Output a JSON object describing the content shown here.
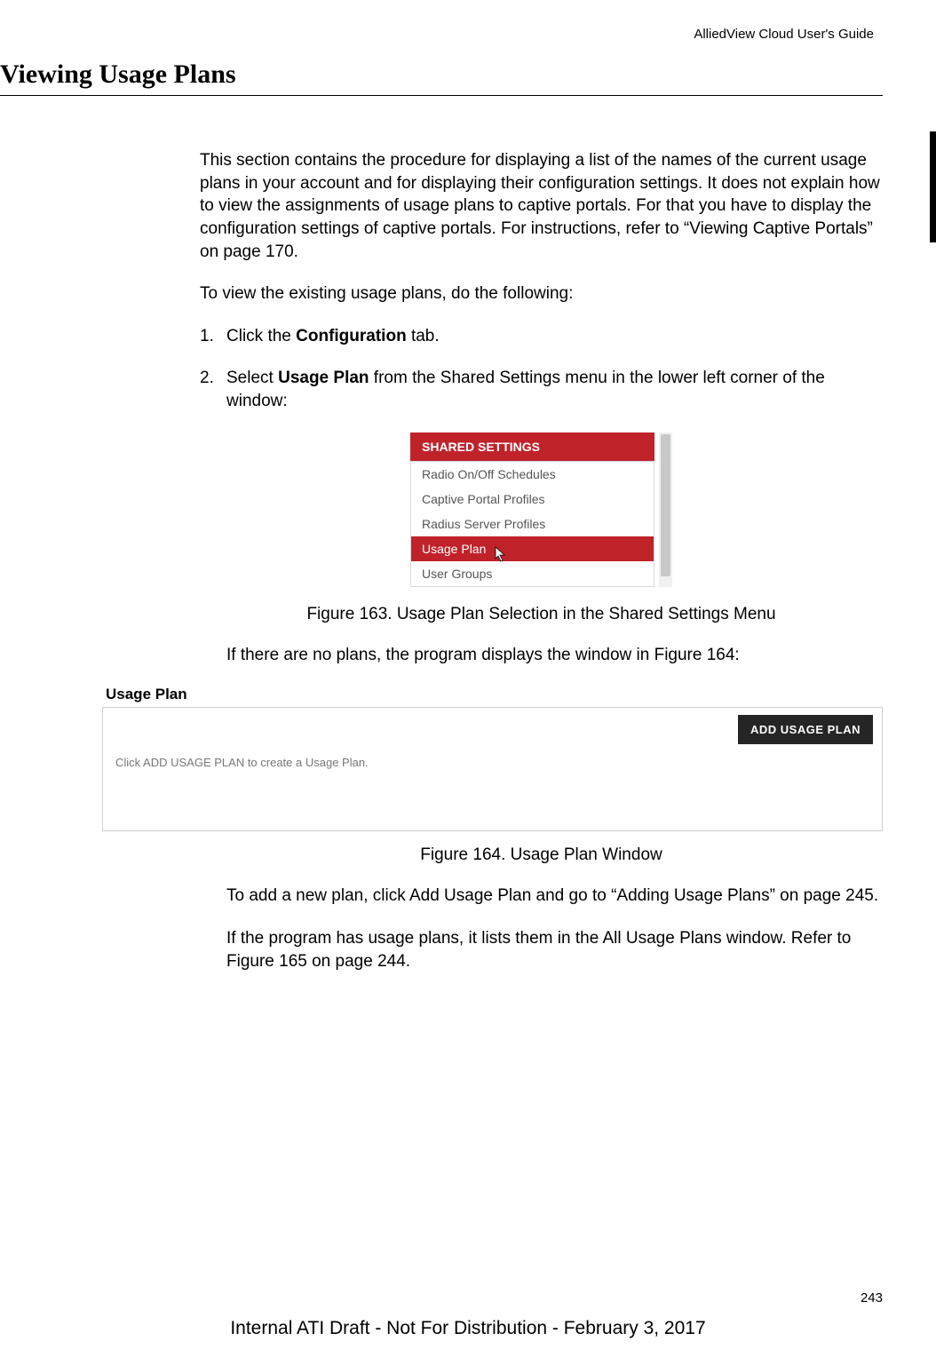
{
  "header": {
    "guide": "AlliedView Cloud User's Guide"
  },
  "title": "Viewing Usage Plans",
  "para1": "This section contains the procedure for displaying a list of the names of the current usage plans in your account and for displaying their configuration settings. It does not explain how to view the assignments of usage plans to captive portals. For that you have to display the configuration settings of captive portals. For instructions, refer to “Viewing Captive Portals” on page 170.",
  "para2": "To view the existing usage plans, do the following:",
  "list": {
    "item1": {
      "num": "1.",
      "pre": "Click the ",
      "bold": "Configuration",
      "post": " tab."
    },
    "item2": {
      "num": "2.",
      "pre": "Select ",
      "bold": "Usage Plan",
      "post": " from the Shared Settings menu in the lower left corner of the window:"
    }
  },
  "shared_settings": {
    "header": "SHARED SETTINGS",
    "items": {
      "i0": "Radio On/Off Schedules",
      "i1": "Captive Portal Profiles",
      "i2": "Radius Server Profiles",
      "i3": "Usage Plan",
      "i4": "User Groups"
    }
  },
  "figure163": "Figure 163. Usage Plan Selection in the Shared Settings Menu",
  "para3": "If there are no plans, the program displays the window in Figure 164:",
  "usage_plan": {
    "title": "Usage Plan",
    "button": "ADD USAGE PLAN",
    "empty": "Click ADD USAGE PLAN to create a Usage Plan."
  },
  "figure164": "Figure 164. Usage Plan Window",
  "para4": "To add a new plan, click Add Usage Plan and go to “Adding Usage Plans” on page 245.",
  "para5": "If the program has usage plans, it lists them in the All Usage Plans window. Refer to Figure 165 on page 244.",
  "page_number": "243",
  "footer": "Internal ATI Draft - Not For Distribution - February 3, 2017"
}
